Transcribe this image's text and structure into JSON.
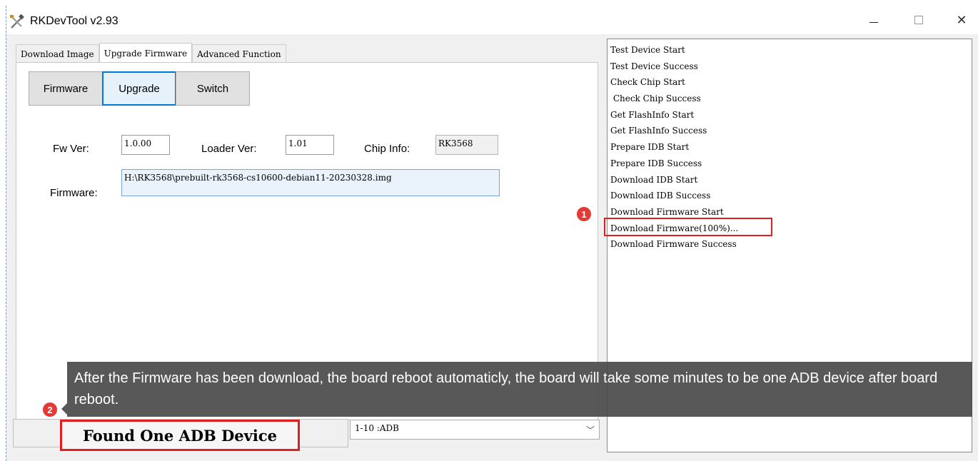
{
  "window": {
    "title": "RKDevTool v2.93"
  },
  "tabs": [
    {
      "label": "Download Image"
    },
    {
      "label": "Upgrade Firmware"
    },
    {
      "label": "Advanced Function"
    }
  ],
  "toolbar": {
    "firmware_label": "Firmware",
    "upgrade_label": "Upgrade",
    "switch_label": "Switch"
  },
  "info": {
    "fw_ver_label": "Fw Ver:",
    "fw_ver_value": "1.0.00",
    "loader_ver_label": "Loader Ver:",
    "loader_ver_value": "1.01",
    "chip_info_label": "Chip Info:",
    "chip_info_value": "RK3568",
    "firmware_label": "Firmware:",
    "firmware_path": "H:\\RK3568\\prebuilt-rk3568-cs10600-debian11-20230328.img"
  },
  "log": [
    "Test Device Start",
    "Test Device Success",
    "Check Chip Start",
    " Check Chip Success",
    "Get FlashInfo Start",
    "Get FlashInfo Success",
    "Prepare IDB Start",
    "Prepare IDB Success",
    "Download IDB Start",
    "Download IDB Success",
    "Download Firmware Start",
    "Download Firmware(100%)...",
    "Download Firmware Success"
  ],
  "status": {
    "text": "Found One ADB Device"
  },
  "device_select": {
    "value": "1-10 :ADB"
  },
  "annotations": {
    "badge_1": "1",
    "badge_2": "2",
    "tooltip": "After the Firmware has been download, the board reboot automaticly, the board will take some minutes to be one ADB device after board reboot."
  },
  "colors": {
    "highlight": "#e02020",
    "badge": "#e53935",
    "tooltip_bg": "#464646",
    "accent": "#0078d7"
  }
}
